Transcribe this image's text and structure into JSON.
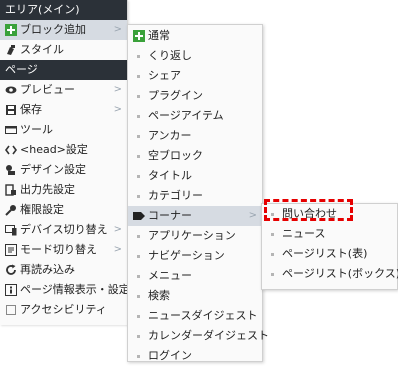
{
  "main_menu": {
    "area_header": "エリア(メイン)",
    "add_block": "ブロック追加",
    "style": "スタイル",
    "page_header": "ページ",
    "preview": "プレビュー",
    "save": "保存",
    "tools": "ツール",
    "head_settings": "<head>設定",
    "design_settings": "デザイン設定",
    "output_settings": "出力先設定",
    "permission_settings": "権限設定",
    "device_switch": "デバイス切り替え",
    "mode_switch": "モード切り替え",
    "reload": "再読み込み",
    "page_info": "ページ情報表示・設定",
    "accessibility": "アクセシビリティ"
  },
  "block_menu": {
    "items": [
      "通常",
      "くり返し",
      "シェア",
      "プラグイン",
      "ページアイテム",
      "アンカー",
      "空ブロック",
      "タイトル",
      "カテゴリー",
      "コーナー",
      "アプリケーション",
      "ナビゲーション",
      "メニュー",
      "検索",
      "ニュースダイジェスト",
      "カレンダーダイジェスト",
      "ログイン"
    ]
  },
  "corner_menu": {
    "items": [
      "問い合わせ",
      "ニュース",
      "ページリスト(表)",
      "ページリスト(ボックス)"
    ]
  },
  "submenu_arrow": ">",
  "icons": {
    "add_block": "plus-icon",
    "style": "paint-icon",
    "preview": "eye-icon",
    "save": "floppy-icon",
    "tools": "toolbar-icon",
    "head_settings": "code-icon",
    "design_settings": "palette-icon",
    "output_settings": "output-icon",
    "permission_settings": "key-icon",
    "device_switch": "device-icon",
    "mode_switch": "mode-icon",
    "reload": "reload-icon",
    "page_info": "info-icon",
    "accessibility": "accessibility-icon",
    "normal_block": "plus-icon",
    "corner": "corner-icon"
  },
  "colors": {
    "header_bg": "#2b3138",
    "menu_bg": "#fafafa",
    "highlight": "#d6dbe2",
    "plus_green": "#3aa13a",
    "annotation_red": "#e60000"
  }
}
